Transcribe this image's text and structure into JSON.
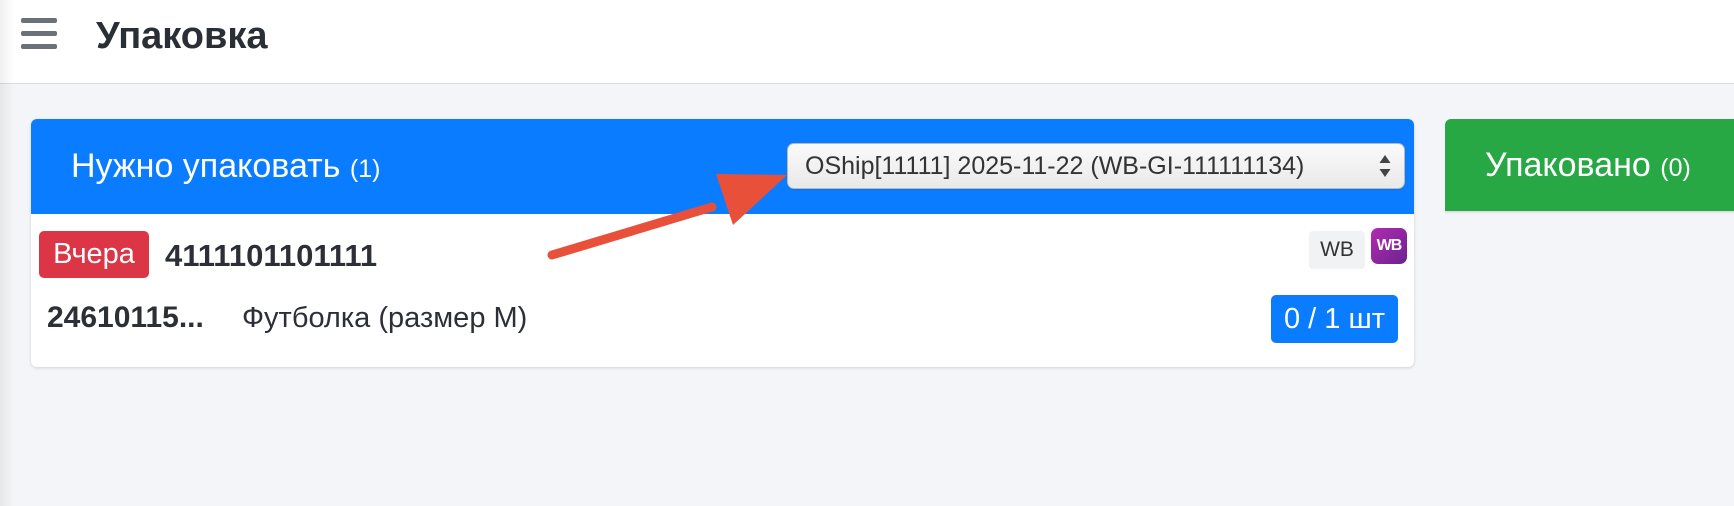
{
  "header": {
    "title": "Упаковка"
  },
  "to_pack": {
    "title": "Нужно упаковать",
    "count": "(1)",
    "shipment_select": {
      "selected": "OShip[11111] 2025-11-22 (WB-GI-111111134)"
    },
    "orders": [
      {
        "date_badge": "Вчера",
        "order_number": "4111101101111",
        "marketplace_tag": "WB",
        "marketplace_logo": "WB",
        "items": [
          {
            "sku": "24610115...",
            "name": "Футболка (размер M)",
            "quantity": "0 / 1 шт"
          }
        ]
      }
    ]
  },
  "packed": {
    "title": "Упаковано",
    "count": "(0)"
  },
  "colors": {
    "primary": "#0a7cff",
    "success": "#27a845",
    "danger": "#dc3545",
    "annotation_arrow": "#e8503a"
  }
}
